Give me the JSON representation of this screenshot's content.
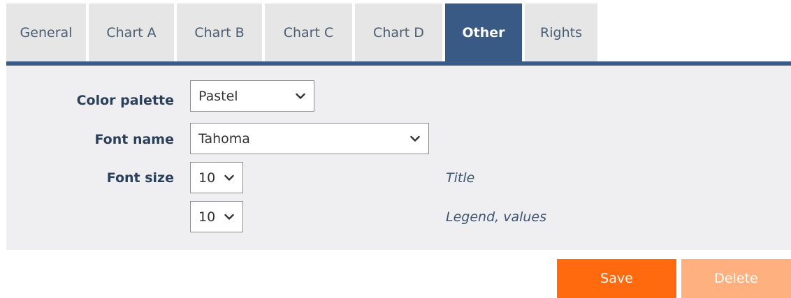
{
  "tabs": [
    {
      "label": "General",
      "active": false
    },
    {
      "label": "Chart A",
      "active": false
    },
    {
      "label": "Chart B",
      "active": false
    },
    {
      "label": "Chart C",
      "active": false
    },
    {
      "label": "Chart D",
      "active": false
    },
    {
      "label": "Other",
      "active": true
    },
    {
      "label": "Rights",
      "active": false
    }
  ],
  "form": {
    "color_palette": {
      "label": "Color palette",
      "value": "Pastel"
    },
    "font_name": {
      "label": "Font name",
      "value": "Tahoma"
    },
    "font_size": {
      "label": "Font size",
      "title_value": "10",
      "title_hint": "Title",
      "legend_value": "10",
      "legend_hint": "Legend, values"
    }
  },
  "actions": {
    "save_label": "Save",
    "delete_label": "Delete"
  },
  "colors": {
    "accent": "#3a5a86",
    "save": "#ff6a0f",
    "delete_disabled": "#ffb07e"
  },
  "icons": {
    "dropdown": "chevron-down-icon"
  }
}
